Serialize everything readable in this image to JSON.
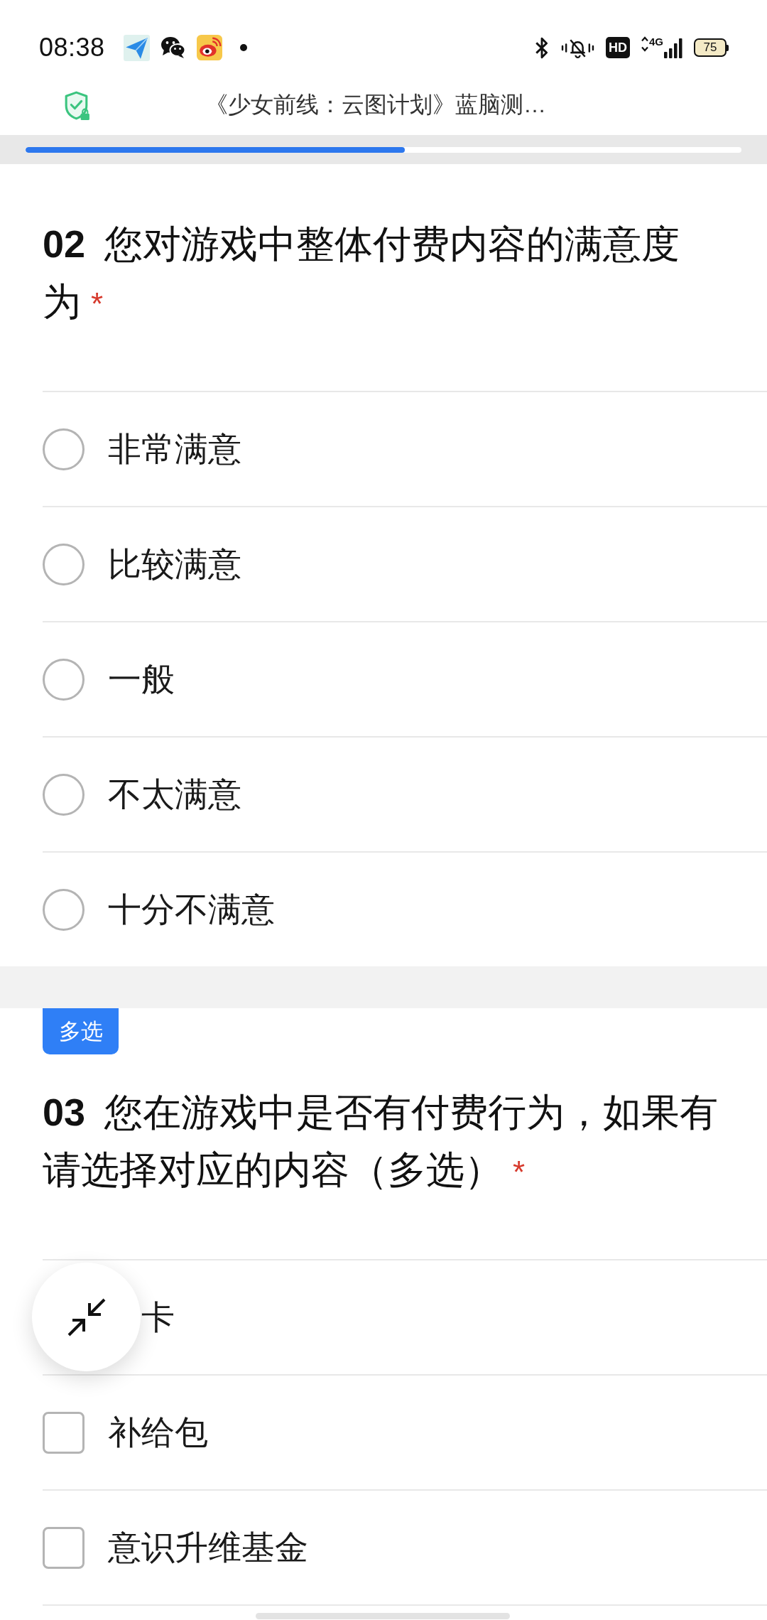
{
  "status_bar": {
    "time": "08:38",
    "hd_label": "HD",
    "network": "4G",
    "battery": "75"
  },
  "header": {
    "title": "《少女前线：云图计划》蓝脑测…"
  },
  "progress": {
    "level": 0.53
  },
  "questions": [
    {
      "number": "02",
      "title": "您对游戏中整体付费内容的满意度为",
      "required_mark": "*",
      "kind": "single",
      "options": [
        {
          "label": "非常满意",
          "selected": false
        },
        {
          "label": "比较满意",
          "selected": false
        },
        {
          "label": "一般",
          "selected": false
        },
        {
          "label": "不太满意",
          "selected": false
        },
        {
          "label": "十分不满意",
          "selected": false
        }
      ]
    },
    {
      "number": "03",
      "tag": "多选",
      "title": "您在游戏中是否有付费行为，如果有请选择对应的内容（多选）",
      "required_mark": "*",
      "kind": "multiple",
      "options": [
        {
          "label": "卡",
          "covered": true
        },
        {
          "label": "补给包",
          "checked": false
        },
        {
          "label": "意识升维基金",
          "checked": false
        }
      ]
    }
  ]
}
